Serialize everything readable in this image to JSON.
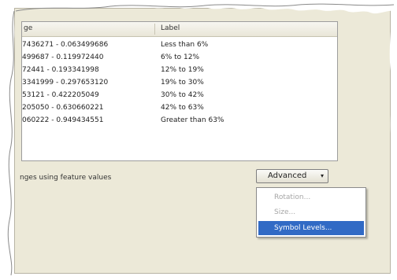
{
  "table": {
    "header_range": "ge",
    "header_label": "Label",
    "rows": [
      {
        "range": "7436271 - 0.063499686",
        "label": "Less than 6%"
      },
      {
        "range": "499687 - 0.119972440",
        "label": "6% to 12%"
      },
      {
        "range": "72441 - 0.193341998",
        "label": "12% to 19%"
      },
      {
        "range": "3341999 - 0.297653120",
        "label": "19% to 30%"
      },
      {
        "range": "53121 - 0.422205049",
        "label": "30% to 42%"
      },
      {
        "range": "205050 - 0.630660221",
        "label": "42% to 63%"
      },
      {
        "range": "060222 - 0.949434551",
        "label": "Greater than 63%"
      }
    ]
  },
  "footer": {
    "text": "nges using feature values"
  },
  "advanced_button": {
    "label": "Advanced",
    "arrow": "▾"
  },
  "menu": {
    "items": [
      {
        "label": "Rotation...",
        "state": "disabled"
      },
      {
        "label": "Size...",
        "state": "disabled"
      },
      {
        "label": "Symbol Levels...",
        "state": "highlighted"
      }
    ]
  },
  "colors": {
    "dialog_bg": "#ece9d8",
    "highlight": "#316ac5"
  }
}
